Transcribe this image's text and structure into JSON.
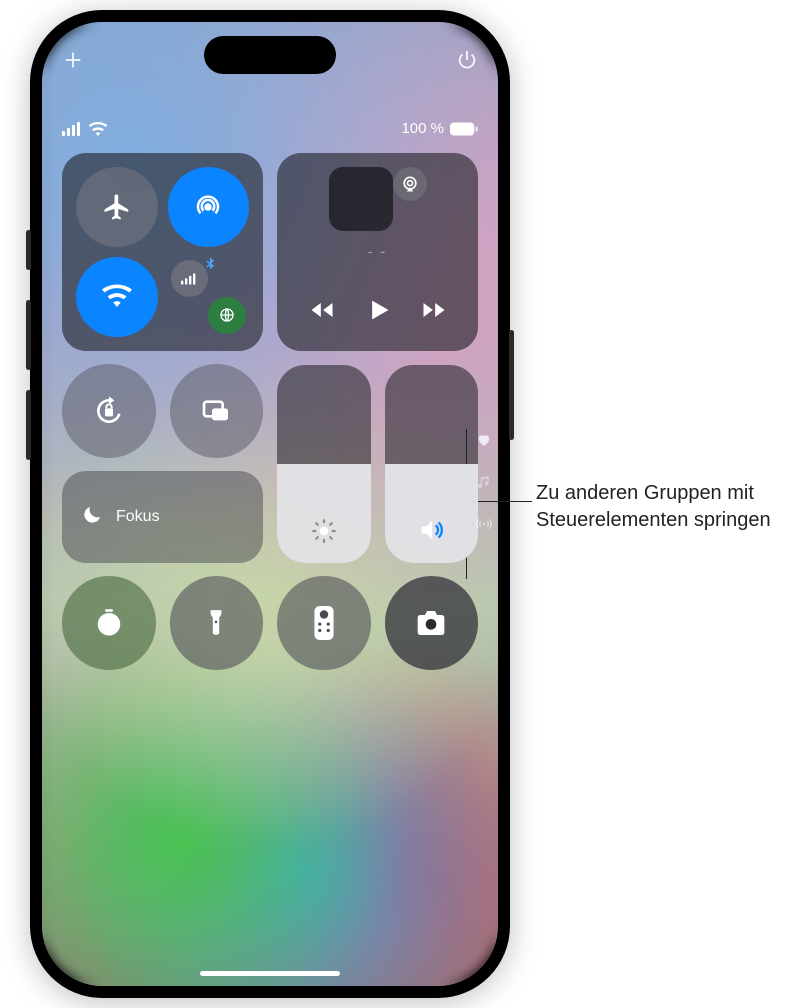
{
  "status": {
    "battery_text": "100 %"
  },
  "connectivity": {
    "airplane": {
      "active": false
    },
    "airdrop": {
      "active": true
    },
    "wifi": {
      "active": true
    },
    "cellular_bluetooth_vpn": {
      "active": false
    }
  },
  "media": {
    "title_placeholder": "- -"
  },
  "focus": {
    "label": "Fokus"
  },
  "sliders": {
    "brightness_percent": 50,
    "volume_percent": 50
  },
  "shortcuts": {
    "timer": "timer",
    "flashlight": "flashlight",
    "remote": "remote",
    "camera": "camera"
  },
  "page_indicators": [
    "favorites",
    "music",
    "connectivity"
  ],
  "callout": {
    "text": "Zu anderen Gruppen mit Steuerelementen springen"
  },
  "colors": {
    "blue": "#0a84ff",
    "green": "#2d7e41"
  }
}
